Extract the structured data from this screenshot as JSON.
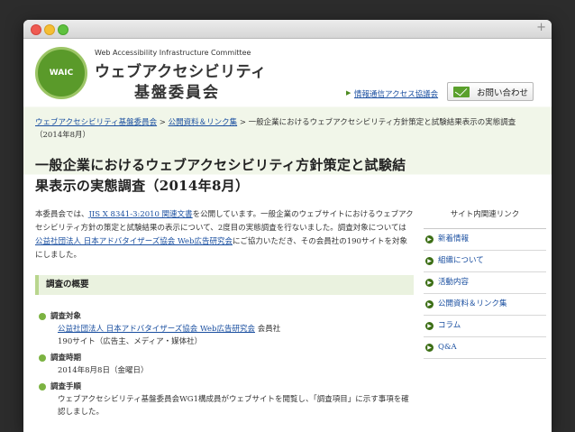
{
  "header": {
    "logo_badge": "WAIC",
    "logo_en": "Web Accessibility Infrastructure Committee",
    "logo_jp_line1": "ウェブアクセシビリティ",
    "logo_jp_line2": "基盤委員会",
    "link_label": "情報通信アクセス協議会",
    "contact_label": "お問い合わせ"
  },
  "breadcrumb": {
    "item1": "ウェブアクセシビリティ基盤委員会",
    "sep": " > ",
    "item2": "公開資料＆リンク集",
    "current": "一般企業におけるウェブアクセシビリティ方針策定と試験結果表示の実態調査（2014年8月）"
  },
  "page": {
    "title": "一般企業におけるウェブアクセシビリティ方針策定と試験結果表示の実態調査（2014年8月）",
    "intro_1": "本委員会では、",
    "intro_link1": "JIS X 8341-3:2010 関連文書",
    "intro_2": "を公開しています。一般企業のウェブサイトにおけるウェブアクセシビリティ方針の策定と試験結果の表示について、2度目の実態調査を行ないました。調査対象については",
    "intro_link2": "公益社団法人 日本アドバタイザーズ協会 Web広告研究会",
    "intro_3": "にご協力いただき、その会員社の190サイトを対象にしました。"
  },
  "section": {
    "heading": "調査の概要",
    "target_label": "調査対象",
    "target_link": "公益社団法人 日本アドバタイザーズ協会 Web広告研究会",
    "target_suffix": " 会員社",
    "target_count": "190サイト（広告主、メディア・媒体社）",
    "period_label": "調査時期",
    "period_value": "2014年8月8日（金曜日）",
    "method_label": "調査手順",
    "method_value": "ウェブアクセシビリティ基盤委員会WG1構成員がウェブサイトを閲覧し、「調査項目」に示す事項を確認しました。"
  },
  "sidebar": {
    "heading": "サイト内関連リンク",
    "items": [
      {
        "label": "新着情報"
      },
      {
        "label": "組織について"
      },
      {
        "label": "活動内容"
      },
      {
        "label": "公開資料＆リンク集"
      },
      {
        "label": "コラム"
      },
      {
        "label": "Q&A"
      }
    ]
  }
}
